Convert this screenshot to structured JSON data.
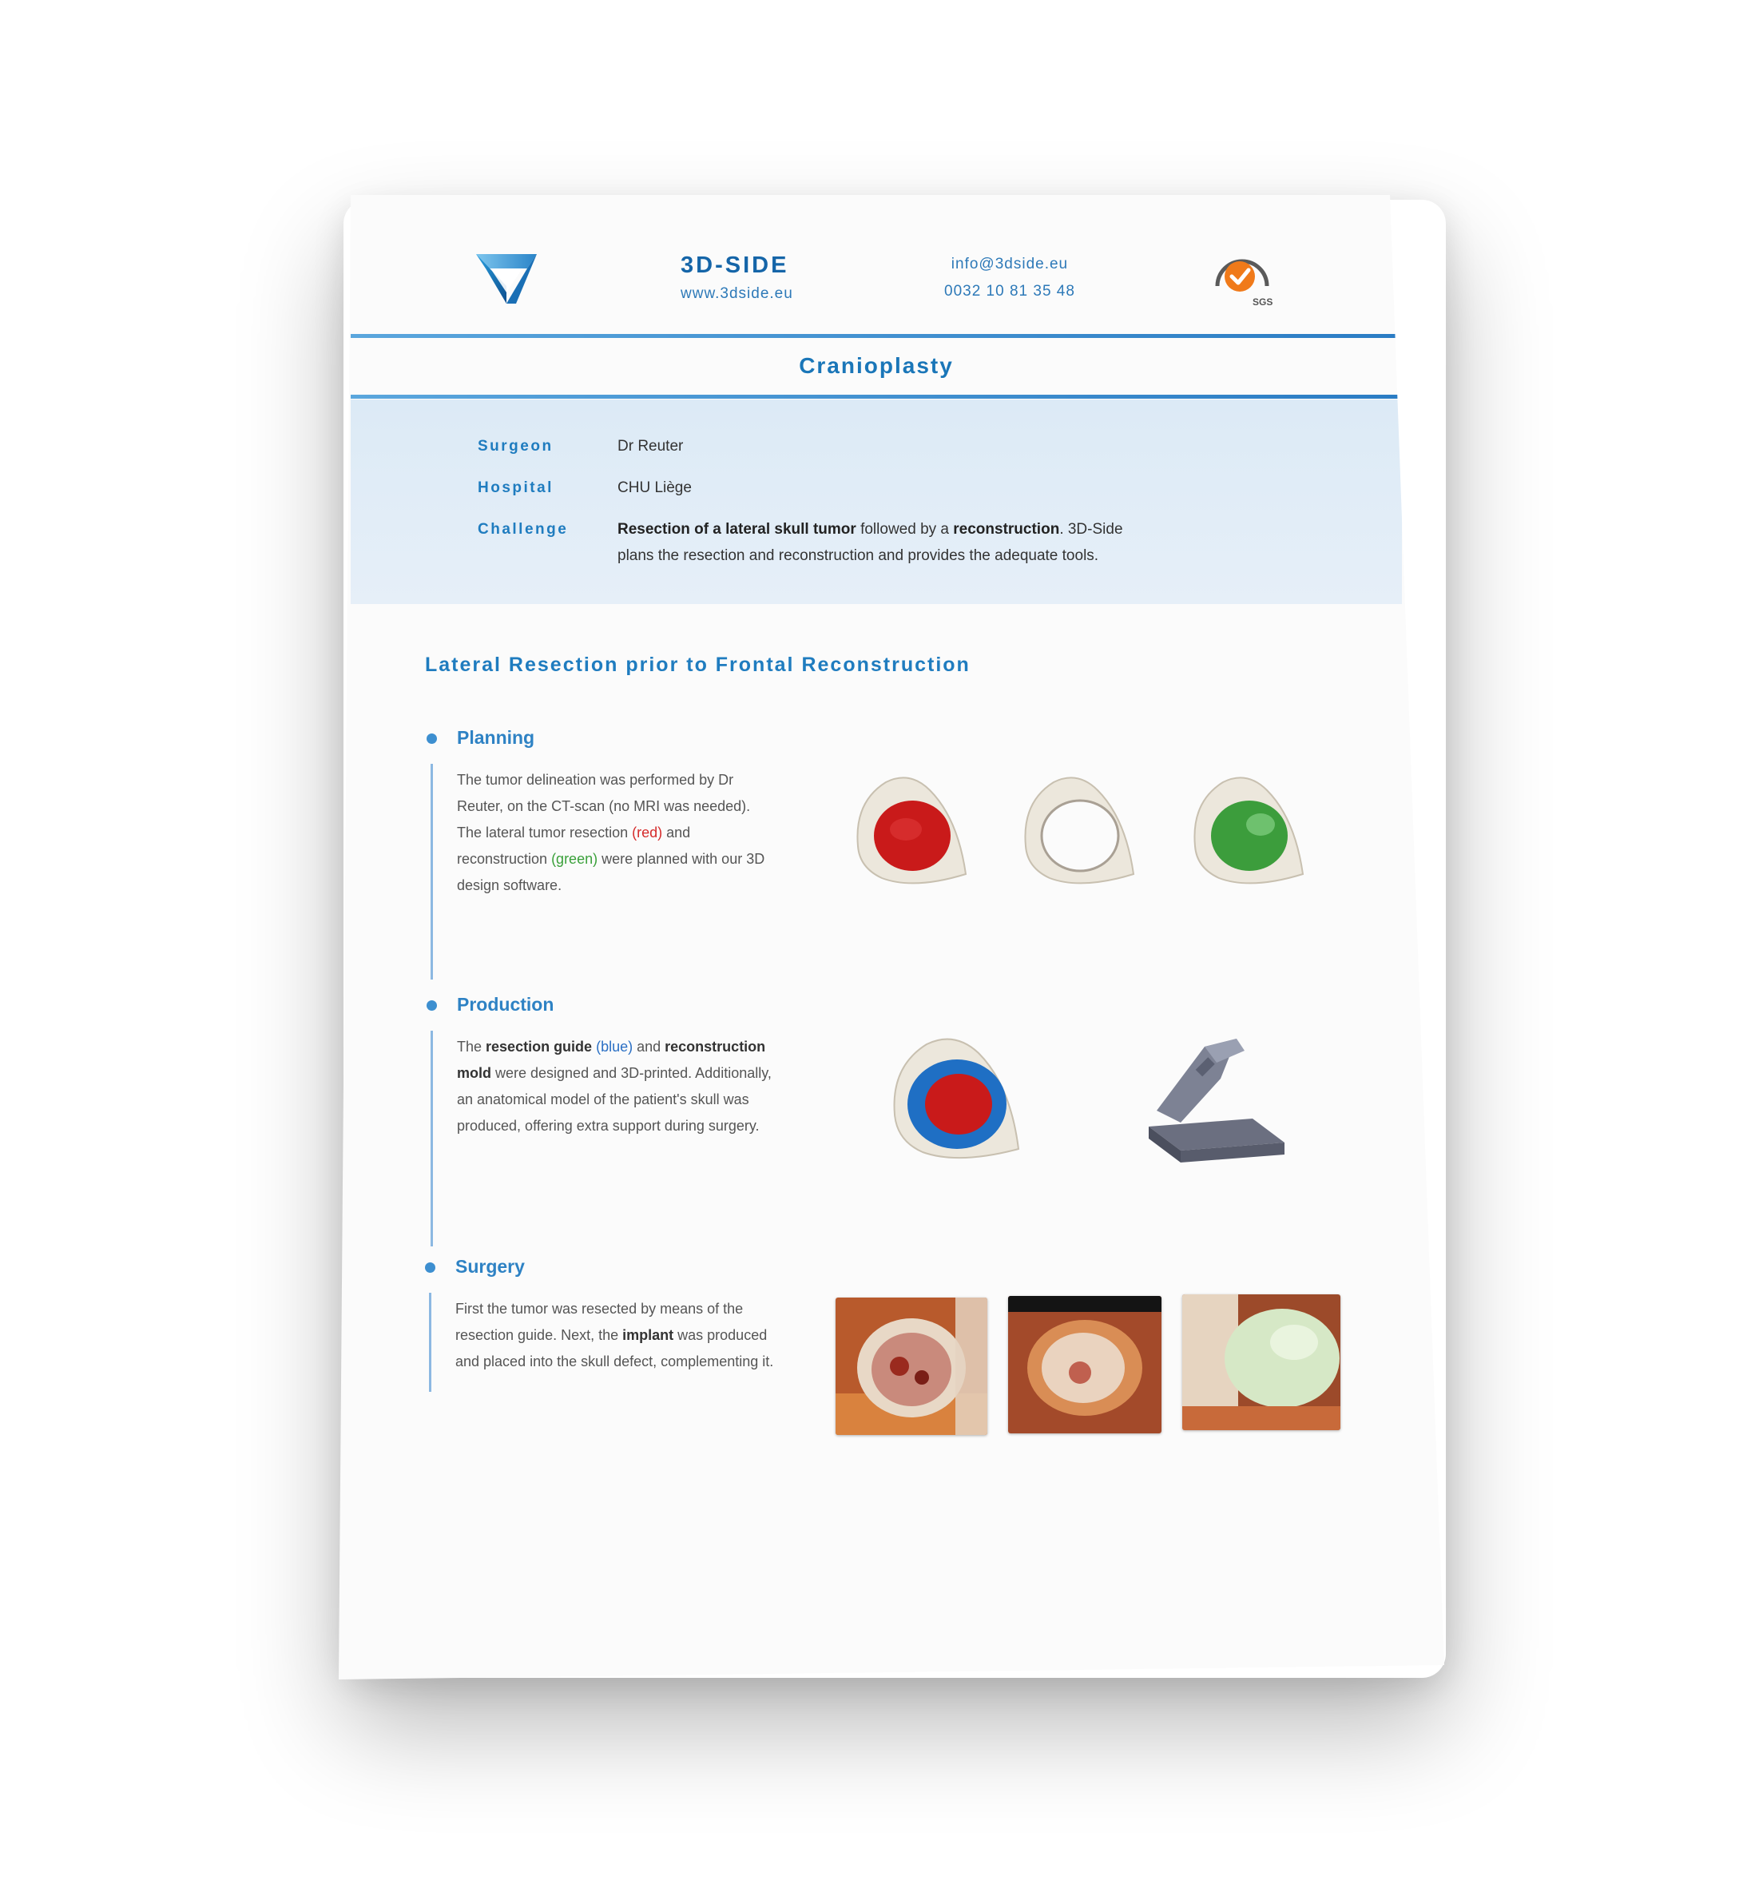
{
  "header": {
    "brand_name": "3D-SIDE",
    "website": "www.3dside.eu",
    "email": "info@3dside.eu",
    "phone": "0032 10 81 35 48",
    "cert_label": "SGS"
  },
  "document": {
    "title": "Cranioplasty",
    "info": {
      "surgeon_label": "Surgeon",
      "surgeon_value": "Dr Reuter",
      "hospital_label": "Hospital",
      "hospital_value": "CHU Liège",
      "challenge_label": "Challenge",
      "challenge_bold_1": "Resection of a lateral skull tumor",
      "challenge_text_1": " followed by a ",
      "challenge_bold_2": "reconstruction",
      "challenge_text_2": ". 3D-Side plans the resection and reconstruction and provides the adequate tools."
    },
    "section_title": "Lateral Resection prior to Frontal Reconstruction",
    "steps": {
      "planning": {
        "title": "Planning",
        "t1": "The tumor delineation was performed by Dr Reuter, on the CT-scan (no MRI was needed). The lateral tumor resection ",
        "red": "(red)",
        "t2": " and reconstruction ",
        "green": "(green)",
        "t3": " were planned with our 3D design software."
      },
      "production": {
        "title": "Production",
        "t1": "The ",
        "b1": "resection guide",
        "t2": " ",
        "blue": "(blue)",
        "t3": " and ",
        "b2": "reconstruction mold",
        "t4": " were designed and 3D-printed. Additionally, an anatomical model of the patient's skull was produced, offering extra support during surgery."
      },
      "surgery": {
        "title": "Surgery",
        "t1": "First the tumor was resected by means of the resection guide. Next, the ",
        "b1": "implant",
        "t2": " was produced and placed into the skull defect, complementing it."
      }
    }
  },
  "colors": {
    "brand_blue": "#1f7cbf",
    "resection_red": "#d52a2a",
    "reconstruction_green": "#3aa03a",
    "guide_blue": "#2a6fc4"
  }
}
